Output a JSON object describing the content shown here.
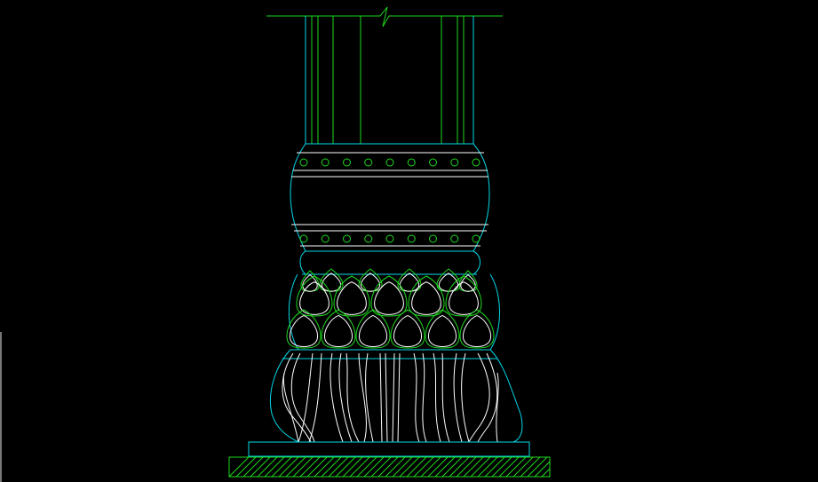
{
  "window": {
    "background": "#000000"
  },
  "colors": {
    "cyan": "#00d8e8",
    "green": "#1ed81e",
    "white": "#ffffff"
  },
  "drawing": {
    "subject": "column-base-elevation",
    "shaft_grooves": 4,
    "studs_per_band": 9,
    "lotus_petals_upper_row": 5,
    "lotus_petals_lower_row": 6,
    "ground_hatching": true
  }
}
